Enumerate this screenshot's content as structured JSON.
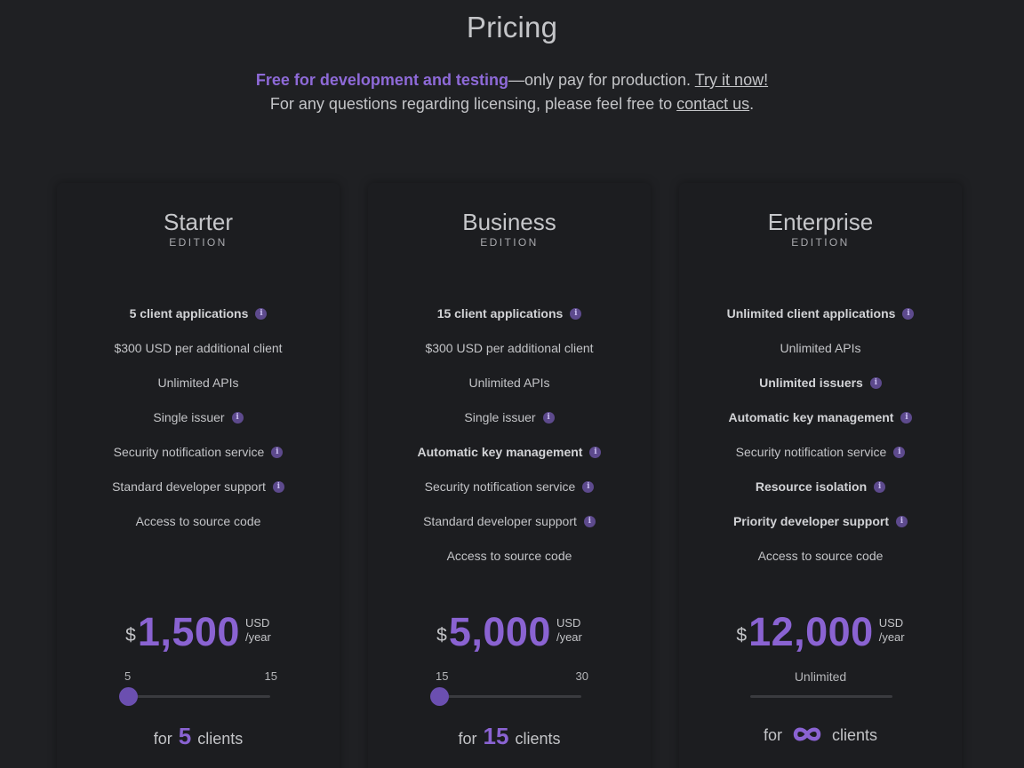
{
  "title": "Pricing",
  "intro": {
    "accent": "Free for development and testing",
    "text1": "—only pay for production. ",
    "try_link": "Try it now!",
    "text2": "For any questions regarding licensing, please feel free to ",
    "contact_link": "contact us",
    "text3": "."
  },
  "colors": {
    "accent": "#8a63d2",
    "background": "#1f2023",
    "card": "#1c1d20"
  },
  "plans": [
    {
      "name": "Starter",
      "edition": "EDITION",
      "features": [
        {
          "text": "5 client applications",
          "bold": true,
          "info": true
        },
        {
          "text": "$300 USD per additional client",
          "bold": false,
          "info": false
        },
        {
          "text": "Unlimited APIs",
          "bold": false,
          "info": false
        },
        {
          "text": "Single issuer",
          "bold": false,
          "info": true
        },
        {
          "text": "Security notification service",
          "bold": false,
          "info": true
        },
        {
          "text": "Standard developer support",
          "bold": false,
          "info": true
        },
        {
          "text": "Access to source code",
          "bold": false,
          "info": false
        }
      ],
      "currency": "$",
      "price": "1,500",
      "unit_currency": "USD",
      "unit_period": "/year",
      "slider_min": "5",
      "slider_max": "15",
      "slider_value": 5,
      "for_label": "for",
      "clients_value": "5",
      "clients_label": "clients"
    },
    {
      "name": "Business",
      "edition": "EDITION",
      "features": [
        {
          "text": "15 client applications",
          "bold": true,
          "info": true
        },
        {
          "text": "$300 USD per additional client",
          "bold": false,
          "info": false
        },
        {
          "text": "Unlimited APIs",
          "bold": false,
          "info": false
        },
        {
          "text": "Single issuer",
          "bold": false,
          "info": true
        },
        {
          "text": "Automatic key management",
          "bold": true,
          "info": true
        },
        {
          "text": "Security notification service",
          "bold": false,
          "info": true
        },
        {
          "text": "Standard developer support",
          "bold": false,
          "info": true
        },
        {
          "text": "Access to source code",
          "bold": false,
          "info": false
        }
      ],
      "currency": "$",
      "price": "5,000",
      "unit_currency": "USD",
      "unit_period": "/year",
      "slider_min": "15",
      "slider_max": "30",
      "slider_value": 15,
      "for_label": "for",
      "clients_value": "15",
      "clients_label": "clients"
    },
    {
      "name": "Enterprise",
      "edition": "EDITION",
      "features": [
        {
          "text": "Unlimited client applications",
          "bold": true,
          "info": true
        },
        {
          "text": "Unlimited APIs",
          "bold": false,
          "info": false
        },
        {
          "text": "Unlimited issuers",
          "bold": true,
          "info": true
        },
        {
          "text": "Automatic key management",
          "bold": true,
          "info": true
        },
        {
          "text": "Security notification service",
          "bold": false,
          "info": true
        },
        {
          "text": "Resource isolation",
          "bold": true,
          "info": true
        },
        {
          "text": "Priority developer support",
          "bold": true,
          "info": true
        },
        {
          "text": "Access to source code",
          "bold": false,
          "info": false
        }
      ],
      "currency": "$",
      "price": "12,000",
      "unit_currency": "USD",
      "unit_period": "/year",
      "slider_label": "Unlimited",
      "for_label": "for",
      "clients_icon": "infinity-icon",
      "clients_label": "clients"
    }
  ],
  "info_icon": "info-icon",
  "info_glyph": "i"
}
